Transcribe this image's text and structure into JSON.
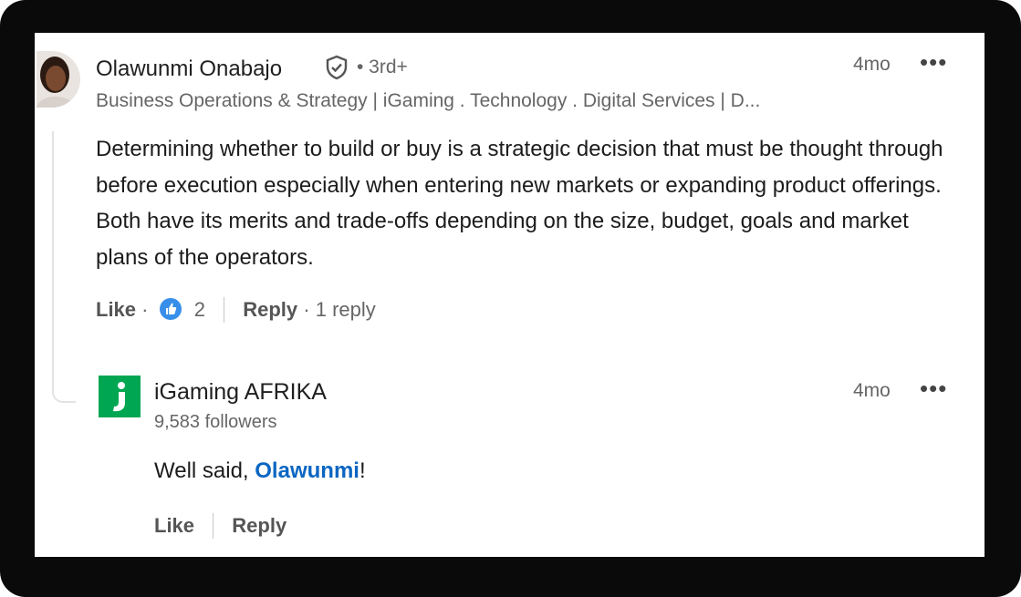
{
  "comment": {
    "author": "Olawunmi Onabajo",
    "verified_icon": "shield-check-icon",
    "degree": "• 3rd+",
    "headline": "Business Operations & Strategy | iGaming . Technology . Digital Services | D...",
    "time": "4mo",
    "more": "•••",
    "text": "Determining whether to build or buy is a strategic decision that must be thought through before execution especially when entering new markets or expanding product offerings. Both have its merits and trade-offs depending on the size, budget, goals and market plans of the operators.",
    "actions": {
      "like": "Like",
      "dot1": "·",
      "reaction_icon": "thumbs-up-icon",
      "reaction_count": "2",
      "reply": "Reply",
      "dot2": "·",
      "reply_count": "1 reply"
    }
  },
  "reply": {
    "author": "iGaming AFRIKA",
    "followers": "9,583 followers",
    "time": "4mo",
    "more": "•••",
    "text_prefix": "Well said, ",
    "mention": "Olawunmi",
    "text_suffix": "!",
    "actions": {
      "like": "Like",
      "reply": "Reply"
    }
  },
  "colors": {
    "accent": "#0a66c2",
    "reaction": "#378fe9",
    "org_logo": "#00a651"
  }
}
